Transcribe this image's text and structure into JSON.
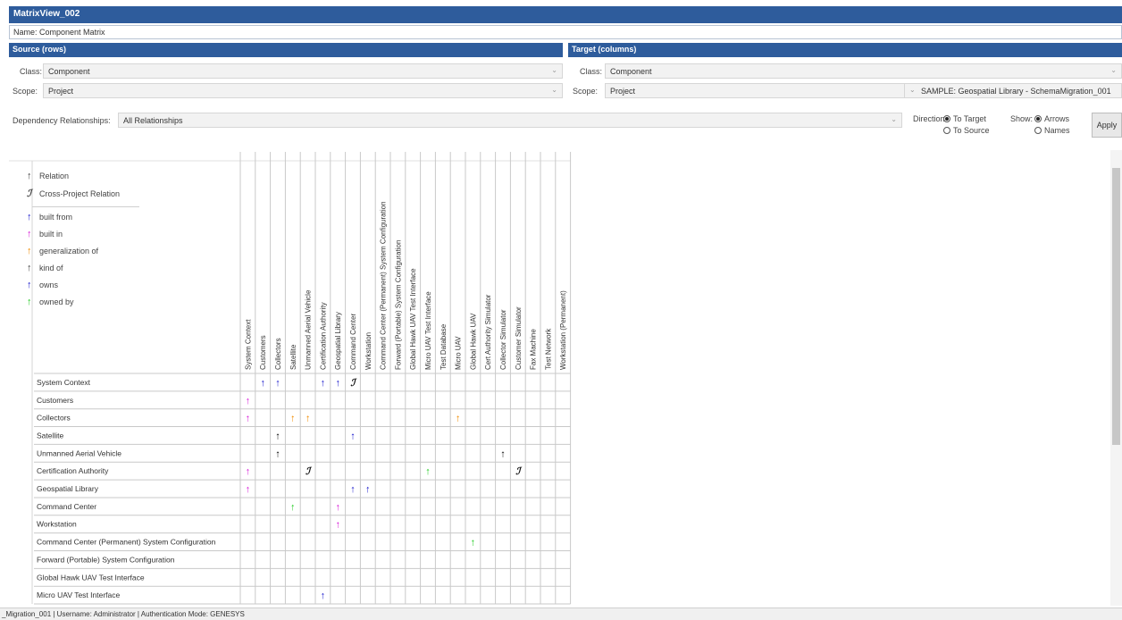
{
  "window": {
    "title": "MatrixView_002"
  },
  "name_field": {
    "label": "Name:",
    "value": "Component Matrix"
  },
  "source": {
    "header": "Source (rows)",
    "class_label": "Class:",
    "class_value": "Component",
    "scope_label": "Scope:",
    "scope_value": "Project"
  },
  "target": {
    "header": "Target (columns)",
    "class_label": "Class:",
    "class_value": "Component",
    "scope_label": "Scope:",
    "scope_value": "Project",
    "project_value": "SAMPLE: Geospatial Library - SchemaMigration_001"
  },
  "dependency": {
    "label": "Dependency Relationships:",
    "value": "All Relationships"
  },
  "direction": {
    "label": "Direction:",
    "options": [
      "To Target",
      "To Source"
    ],
    "selected": 0
  },
  "show": {
    "label": "Show:",
    "options": [
      "Arrows",
      "Names"
    ],
    "selected": 0
  },
  "apply_label": "Apply",
  "legend": [
    {
      "label": "Relation",
      "color": "#111111",
      "glyph": "arrow"
    },
    {
      "label": "Cross-Project Relation",
      "color": "#111111",
      "glyph": "cross"
    },
    {
      "label": "built from",
      "color": "#1a1acc",
      "glyph": "arrow"
    },
    {
      "label": "built in",
      "color": "#d81bd8",
      "glyph": "arrow"
    },
    {
      "label": "generalization of",
      "color": "#f28c00",
      "glyph": "arrow"
    },
    {
      "label": "kind of",
      "color": "#111111",
      "glyph": "arrow"
    },
    {
      "label": "owns",
      "color": "#1a1acc",
      "glyph": "arrow"
    },
    {
      "label": "owned by",
      "color": "#22cc22",
      "glyph": "arrow"
    }
  ],
  "glyphs": {
    "arrow": "↑",
    "cross": "ℐ"
  },
  "columns": [
    "System Context",
    "Customers",
    "Collectors",
    "Satellite",
    "Unmanned Aerial Vehicle",
    "Certification Authority",
    "Geospatial Library",
    "Command Center",
    "Workstation",
    "Command Center (Permanent) System Configuration",
    "Forward (Portable) System Configuration",
    "Global Hawk UAV Test Interface",
    "Micro UAV Test Interface",
    "Test Database",
    "Micro UAV",
    "Global Hawk UAV",
    "Cert Authority Simulator",
    "Collector Simulator",
    "Customer Simulator",
    "Fax Machine",
    "Test Network",
    "Workstation (Permanent)"
  ],
  "rows": [
    "System Context",
    "Customers",
    "Collectors",
    "Satellite",
    "Unmanned Aerial Vehicle",
    "Certification Authority",
    "Geospatial Library",
    "Command Center",
    "Workstation",
    "Command Center (Permanent) System Configuration",
    "Forward (Portable) System Configuration",
    "Global Hawk UAV Test Interface",
    "Micro UAV Test Interface"
  ],
  "cells": [
    {
      "r": 0,
      "c": 1,
      "type": "built from"
    },
    {
      "r": 0,
      "c": 2,
      "type": "built from"
    },
    {
      "r": 0,
      "c": 5,
      "type": "built from"
    },
    {
      "r": 0,
      "c": 6,
      "type": "built from"
    },
    {
      "r": 0,
      "c": 7,
      "type": "cross"
    },
    {
      "r": 1,
      "c": 0,
      "type": "built in"
    },
    {
      "r": 2,
      "c": 0,
      "type": "built in"
    },
    {
      "r": 2,
      "c": 3,
      "type": "generalization of"
    },
    {
      "r": 2,
      "c": 4,
      "type": "generalization of"
    },
    {
      "r": 2,
      "c": 14,
      "type": "generalization of"
    },
    {
      "r": 3,
      "c": 2,
      "type": "kind of"
    },
    {
      "r": 3,
      "c": 7,
      "type": "owns"
    },
    {
      "r": 4,
      "c": 2,
      "type": "kind of"
    },
    {
      "r": 4,
      "c": 17,
      "type": "kind of"
    },
    {
      "r": 5,
      "c": 0,
      "type": "built in"
    },
    {
      "r": 5,
      "c": 4,
      "type": "cross"
    },
    {
      "r": 5,
      "c": 12,
      "type": "owned by"
    },
    {
      "r": 5,
      "c": 18,
      "type": "cross"
    },
    {
      "r": 6,
      "c": 0,
      "type": "built in"
    },
    {
      "r": 6,
      "c": 7,
      "type": "owns"
    },
    {
      "r": 6,
      "c": 8,
      "type": "owns"
    },
    {
      "r": 7,
      "c": 3,
      "type": "owned by"
    },
    {
      "r": 7,
      "c": 6,
      "type": "built in"
    },
    {
      "r": 8,
      "c": 6,
      "type": "built in"
    },
    {
      "r": 9,
      "c": 15,
      "type": "owned by"
    },
    {
      "r": 12,
      "c": 5,
      "type": "owns"
    }
  ],
  "status_bar": "_Migration_001 | Username: Administrator | Authentication Mode: GENESYS"
}
